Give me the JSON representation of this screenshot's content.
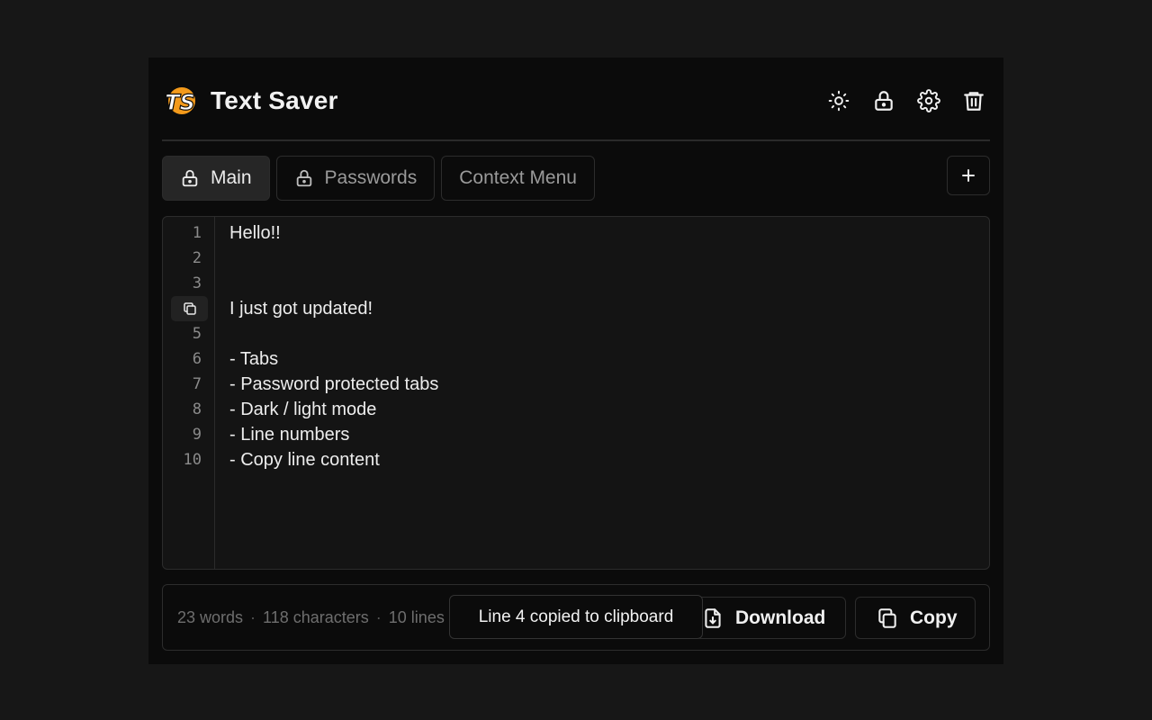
{
  "app": {
    "title": "Text Saver",
    "logo_text": "TS"
  },
  "header_actions": [
    {
      "name": "theme-toggle",
      "icon": "sun-icon"
    },
    {
      "name": "lock",
      "icon": "lock-icon"
    },
    {
      "name": "settings",
      "icon": "gear-icon"
    },
    {
      "name": "delete",
      "icon": "trash-icon"
    }
  ],
  "tabs": [
    {
      "label": "Main",
      "locked": true,
      "active": true
    },
    {
      "label": "Passwords",
      "locked": true,
      "active": false
    },
    {
      "label": "Context Menu",
      "locked": false,
      "active": false
    }
  ],
  "editor": {
    "line_numbers": [
      "1",
      "2",
      "3",
      "",
      "5",
      "6",
      "7",
      "8",
      "9",
      "10"
    ],
    "copy_line_index": 4,
    "lines": [
      "Hello!!",
      "",
      "",
      "I just got updated!",
      "",
      "- Tabs",
      "- Password protected tabs",
      "- Dark / light mode",
      "- Line numbers",
      "- Copy line content"
    ]
  },
  "stats": {
    "words": "23 words",
    "characters": "118 characters",
    "lines": "10 lines"
  },
  "toast": {
    "text": "Line 4 copied to clipboard"
  },
  "buttons": {
    "download": "Download",
    "copy": "Copy"
  },
  "colors": {
    "accent": "#f39a1b",
    "background": "#171717",
    "panel": "#0b0b0b"
  }
}
